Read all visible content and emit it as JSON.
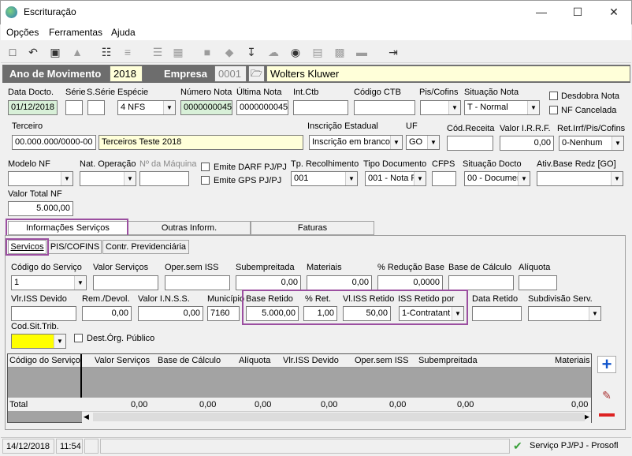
{
  "window": {
    "title": "Escrituração"
  },
  "menu": [
    "Opções",
    "Ferramentas",
    "Ajuda"
  ],
  "header": {
    "ano_label": "Ano de Movimento",
    "ano_value": "2018",
    "empresa_label": "Empresa",
    "empresa_code": "0001",
    "empresa_name": "Wolters Kluwer"
  },
  "form": {
    "data_docto_label": "Data Docto.",
    "data_docto": "01/12/2018",
    "serie_label": "Série",
    "sserie_label": "S.Série",
    "especie_label": "Espécie",
    "especie": "4 NFS",
    "numero_nota_label": "Número Nota",
    "numero_nota": "0000000045",
    "ultima_nota_label": "Última Nota",
    "ultima_nota": "0000000045",
    "int_ctb_label": "Int.Ctb",
    "codigo_ctb_label": "Código CTB",
    "pis_cofins_label": "Pis/Cofins",
    "situacao_nota_label": "Situação Nota",
    "situacao_nota": "T - Normal",
    "desdobra_nota": "Desdobra Nota",
    "nf_cancelada": "NF Cancelada",
    "terceiro_label": "Terceiro",
    "terceiro_doc": "00.000.000/0000-00",
    "terceiro_name": "Terceiros Teste 2018",
    "insc_est_label": "Inscrição Estadual",
    "insc_est": "Inscrição em branco",
    "uf_label": "UF",
    "uf": "GO",
    "cod_receita_label": "Cód.Receita",
    "valor_irrf_label": "Valor I.R.R.F.",
    "valor_irrf": "0,00",
    "ret_label": "Ret.Irrf/Pis/Cofins",
    "ret": "0-Nenhum",
    "modelo_nf_label": "Modelo NF",
    "nat_op_label": "Nat. Operação",
    "maquina_label": "Nº da Máquina",
    "emite_darf": "Emite DARF PJ/PJ",
    "emite_gps": "Emite GPS PJ/PJ",
    "tp_recolh_label": "Tp. Recolhimento",
    "tp_recolh": "001",
    "tipo_doc_label": "Tipo Documento",
    "tipo_doc": "001 - Nota F",
    "cfps_label": "CFPS",
    "sit_docto_label": "Situação Docto",
    "sit_docto": "00 - Documer",
    "ativ_label": "Ativ.Base Redz [GO]",
    "valor_total_label": "Valor Total NF",
    "valor_total": "5.000,00"
  },
  "tabs": [
    "Informações Serviços",
    "Outras Inform.",
    "Faturas"
  ],
  "subtabs": [
    "Servicos",
    "PIS/COFINS",
    "Contr. Previdenciária"
  ],
  "serv": {
    "cod_servico_label": "Código do Serviço",
    "cod_servico": "1",
    "valor_serv_label": "Valor Serviços",
    "oper_iss_label": "Oper.sem ISS",
    "subempreitada_label": "Subempreitada",
    "subempreitada": "0,00",
    "materiais_label": "Materiais",
    "materiais": "0,00",
    "reducao_label": "% Redução Base",
    "reducao": "0,0000",
    "base_calc_label": "Base de Cálculo",
    "aliquota_label": "Alíquota",
    "vlr_iss_label": "Vlr.ISS Devido",
    "rem_devol_label": "Rem./Devol.",
    "rem_devol": "0,00",
    "valor_inss_label": "Valor I.N.S.S.",
    "valor_inss": "0,00",
    "municipio_label": "Município",
    "municipio": "7160",
    "base_retido_label": "Base Retido",
    "base_retido": "5.000,00",
    "pct_ret_label": "% Ret.",
    "pct_ret": "1,00",
    "vl_iss_ret_label": "Vl.ISS Retido",
    "vl_iss_ret": "50,00",
    "iss_ret_por_label": "ISS Retido por",
    "iss_ret_por": "1-Contratant",
    "data_retido_label": "Data Retido",
    "subdiv_label": "Subdivisão Serv.",
    "cod_sit_label": "Cod.Sit.Trib.",
    "dest_org": "Dest.Órg. Público"
  },
  "grid": {
    "columns": [
      "Código do Serviço",
      "Valor Serviços",
      "Base de Cálculo",
      "Alíquota",
      "Vlr.ISS Devido",
      "Oper.sem ISS",
      "Subempreitada",
      "Materiais"
    ],
    "total_label": "Total",
    "totals": [
      "0,00",
      "0,00",
      "0,00",
      "0,00",
      "0,00",
      "0,00",
      "0,00"
    ]
  },
  "status": {
    "date": "14/12/2018",
    "time": "11:54",
    "module": "Serviço PJ/PJ - Prosofl"
  }
}
